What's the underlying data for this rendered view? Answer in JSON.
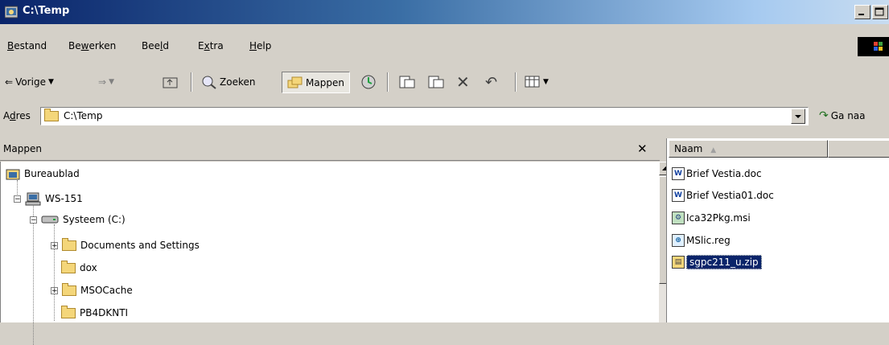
{
  "window": {
    "title": "C:\\Temp"
  },
  "menu": {
    "items": [
      {
        "label_pre": "",
        "accel": "B",
        "label_post": "estand"
      },
      {
        "label_pre": "Be",
        "accel": "w",
        "label_post": "erken"
      },
      {
        "label_pre": "Bee",
        "accel": "l",
        "label_post": "d"
      },
      {
        "label_pre": "E",
        "accel": "x",
        "label_post": "tra"
      },
      {
        "label_pre": "",
        "accel": "H",
        "label_post": "elp"
      }
    ]
  },
  "toolbar": {
    "back_label": "Vorige",
    "search_label": "Zoeken",
    "folders_label": "Mappen"
  },
  "address": {
    "label_pre": "A",
    "accel": "d",
    "label_post": "res",
    "value": "C:\\Temp",
    "go_label": "Ga naa"
  },
  "folders_pane": {
    "title": "Mappen",
    "close_glyph": "✕",
    "tree": [
      {
        "label": "Bureaublad",
        "level": 0
      },
      {
        "label": "WS-151",
        "level": 1
      },
      {
        "label": "Systeem (C:)",
        "level": 2
      },
      {
        "label": "Documents and Settings",
        "level": 3
      },
      {
        "label": "dox",
        "level": 3
      },
      {
        "label": "MSOCache",
        "level": 3
      },
      {
        "label": "PB4DKNTI",
        "level": 3
      }
    ]
  },
  "file_list": {
    "column_name": "Naam",
    "files": [
      {
        "name": "Brief Vestia.doc",
        "icon": "word-doc-icon",
        "selected": false
      },
      {
        "name": "Brief Vestia01.doc",
        "icon": "word-doc-icon",
        "selected": false
      },
      {
        "name": "Ica32Pkg.msi",
        "icon": "installer-icon",
        "selected": false
      },
      {
        "name": "MSlic.reg",
        "icon": "registry-file-icon",
        "selected": false
      },
      {
        "name": "sgpc211_u.zip",
        "icon": "zip-file-icon",
        "selected": true
      }
    ]
  },
  "colors": {
    "selection": "#0a246a",
    "window_face": "#d4d0c8"
  }
}
